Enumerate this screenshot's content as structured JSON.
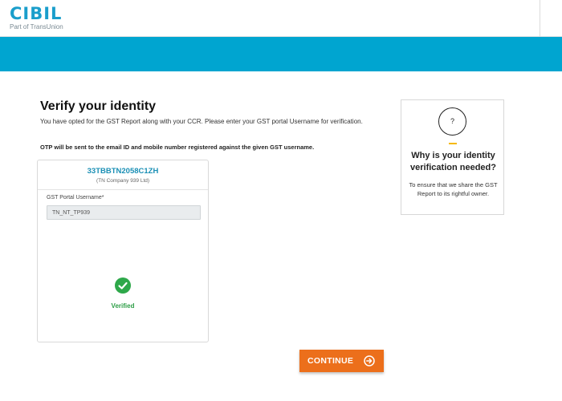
{
  "header": {
    "logo_text": "CIBIL",
    "logo_subtext": "Part of TransUnion"
  },
  "colors": {
    "brand_blue": "#00a5d0",
    "logo_blue": "#1a9ecb",
    "button_orange": "#ec6f1b",
    "verified_green": "#2ea84a",
    "accent_yellow": "#f5b800"
  },
  "main": {
    "title": "Verify your identity",
    "description": "You have opted for the GST Report along with your CCR. Please enter your GST portal Username for verification.",
    "otp_note": "OTP will be sent to the email ID and mobile number registered against the given GST username."
  },
  "gst_card": {
    "gstin": "33TBBTN2058C1ZH",
    "company": "(TN Company 939 Ltd)",
    "field_label": "GST Portal Username*",
    "field_value": "TN_NT_TP939",
    "status": "Verified",
    "status_icon": "check-icon"
  },
  "info_card": {
    "icon": "question-icon",
    "icon_text": "?",
    "title": "Why is your identity verification needed?",
    "text": "To ensure that we share the GST Report to its rightful owner."
  },
  "actions": {
    "continue_label": "CONTINUE",
    "continue_icon": "arrow-right-circle-icon"
  }
}
